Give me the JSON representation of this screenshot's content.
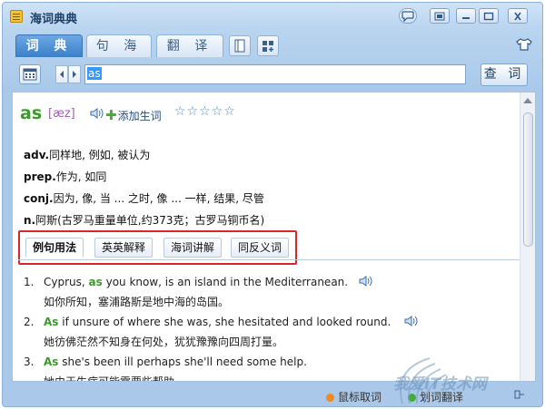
{
  "window": {
    "title": "海词典典"
  },
  "tabs": [
    {
      "label": "词 典",
      "active": true
    },
    {
      "label": "句 海",
      "active": false
    },
    {
      "label": "翻 译",
      "active": false
    }
  ],
  "search": {
    "value": "as",
    "button_label": "查 词"
  },
  "entry": {
    "headword": "as",
    "phonetic": "[æz]",
    "add_word_label": "添加生词",
    "stars": "☆☆☆☆☆",
    "definitions": [
      {
        "pos": "adv.",
        "text": "同样地, 例如, 被认为"
      },
      {
        "pos": "prep.",
        "text": "作为, 如同"
      },
      {
        "pos": "conj.",
        "text": "因为, 像, 当 ... 之时, 像 ... 一样, 结果, 尽管"
      },
      {
        "pos": "n.",
        "text": "阿斯(古罗马重量单位,约373克；古罗马铜币名)"
      }
    ]
  },
  "sub_tabs": [
    {
      "label": "例句用法",
      "active": true
    },
    {
      "label": "英英解释",
      "active": false
    },
    {
      "label": "海词讲解",
      "active": false
    },
    {
      "label": "同反义词",
      "active": false
    }
  ],
  "examples": [
    {
      "num": "1.",
      "pre": "Cyprus, ",
      "hl": "as",
      "post": " you know, is an island in the Mediterranean.",
      "cn": "如你所知，塞浦路斯是地中海的岛国。"
    },
    {
      "num": "2.",
      "pre": "",
      "hl": "As",
      "post": " if unsure of where she was, she hesitated and looked round.",
      "cn": "她彷佛茫然不知身在何处，犹犹豫豫向四周打量。"
    },
    {
      "num": "3.",
      "pre": "",
      "hl": "As",
      "post": " she's been ill perhaps she'll need some help.",
      "cn": "她由于生病可能需要些帮助。"
    }
  ],
  "statusbar": {
    "mouse_lookup": "鼠标取词",
    "screen_lookup": "划词翻译"
  },
  "watermark": "我爱IT技术网",
  "colors": {
    "accent": "#3a7fc9",
    "headword": "#3b9a2a",
    "highlight_border": "#d8262a"
  }
}
